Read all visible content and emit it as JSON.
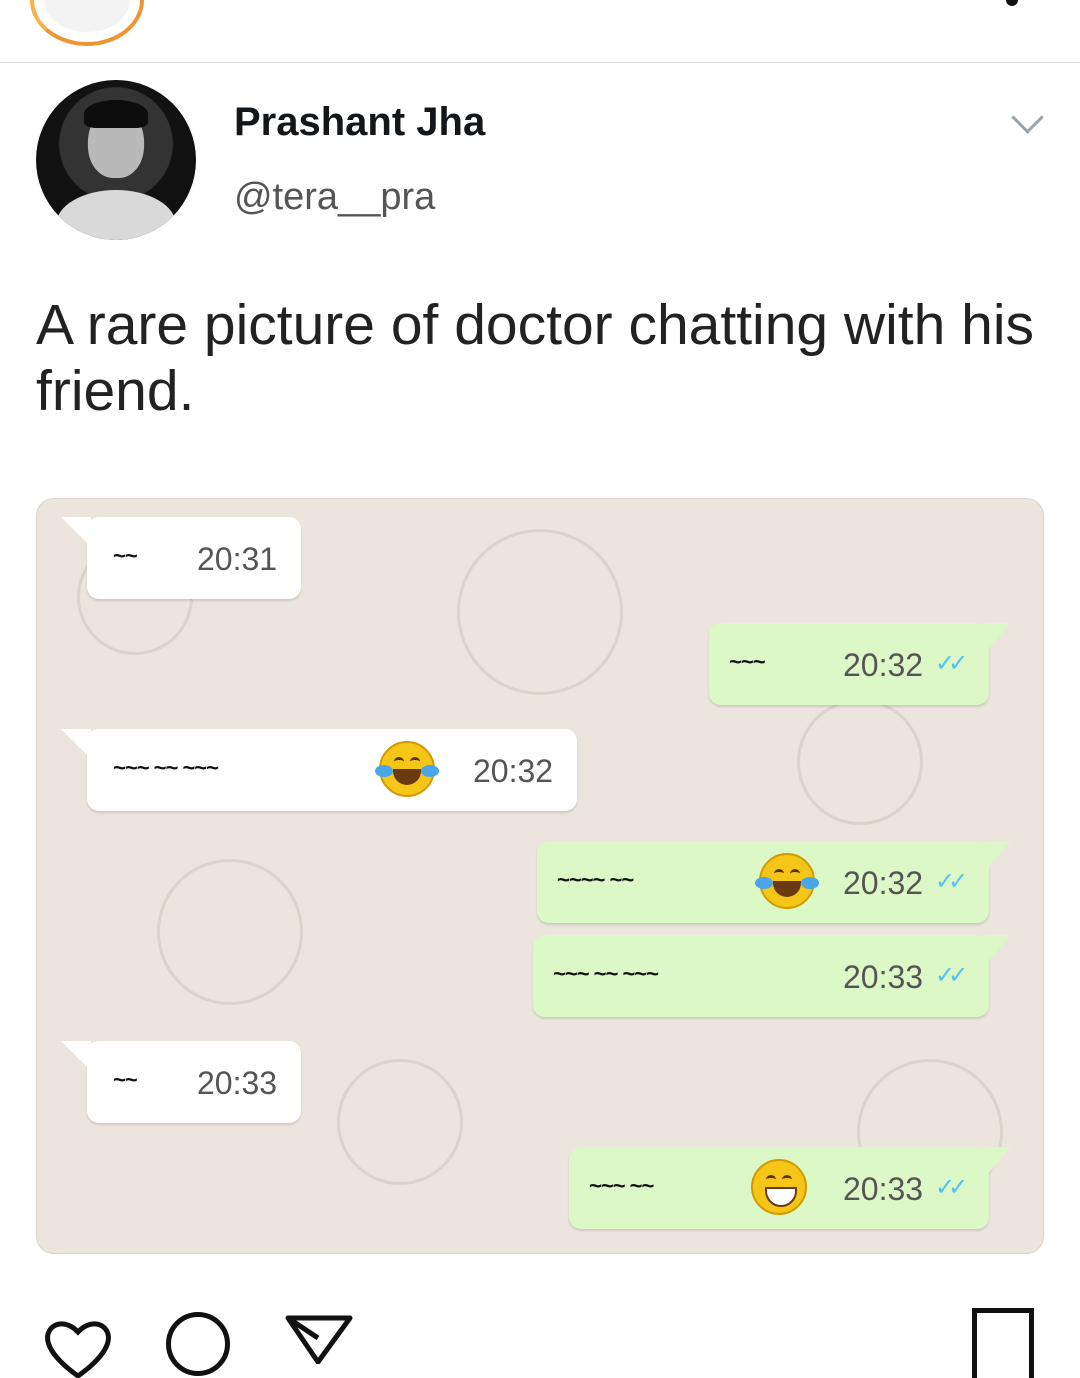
{
  "post": {
    "author_name": "Prashant Jha",
    "author_handle": "@tera__pra",
    "tweet_text": "A rare picture of doctor chatting with his friend."
  },
  "chat": {
    "messages": [
      {
        "direction": "in",
        "text": "~~",
        "time": "20:31",
        "emoji": null
      },
      {
        "direction": "out",
        "text": "~~~",
        "time": "20:32",
        "emoji": null,
        "ticks": "✓✓"
      },
      {
        "direction": "in",
        "text": "~~~ ~~ ~~~",
        "time": "20:32",
        "emoji": "face-with-tears-of-joy-icon"
      },
      {
        "direction": "out",
        "text": "~~~~ ~~",
        "time": "20:32",
        "emoji": "face-with-tears-of-joy-icon",
        "ticks": "✓✓"
      },
      {
        "direction": "out",
        "text": "~~~ ~~ ~~~",
        "time": "20:33",
        "emoji": null,
        "ticks": "✓✓"
      },
      {
        "direction": "in",
        "text": "~~",
        "time": "20:33",
        "emoji": null
      },
      {
        "direction": "out",
        "text": "~~~ ~~",
        "time": "20:33",
        "emoji": "grinning-face-icon",
        "ticks": "✓✓"
      }
    ]
  },
  "colors": {
    "incoming_bubble": "#ffffff",
    "outgoing_bubble": "#dcf8c6",
    "chat_background": "#ebe5dd",
    "read_ticks": "#4fc3f7"
  }
}
